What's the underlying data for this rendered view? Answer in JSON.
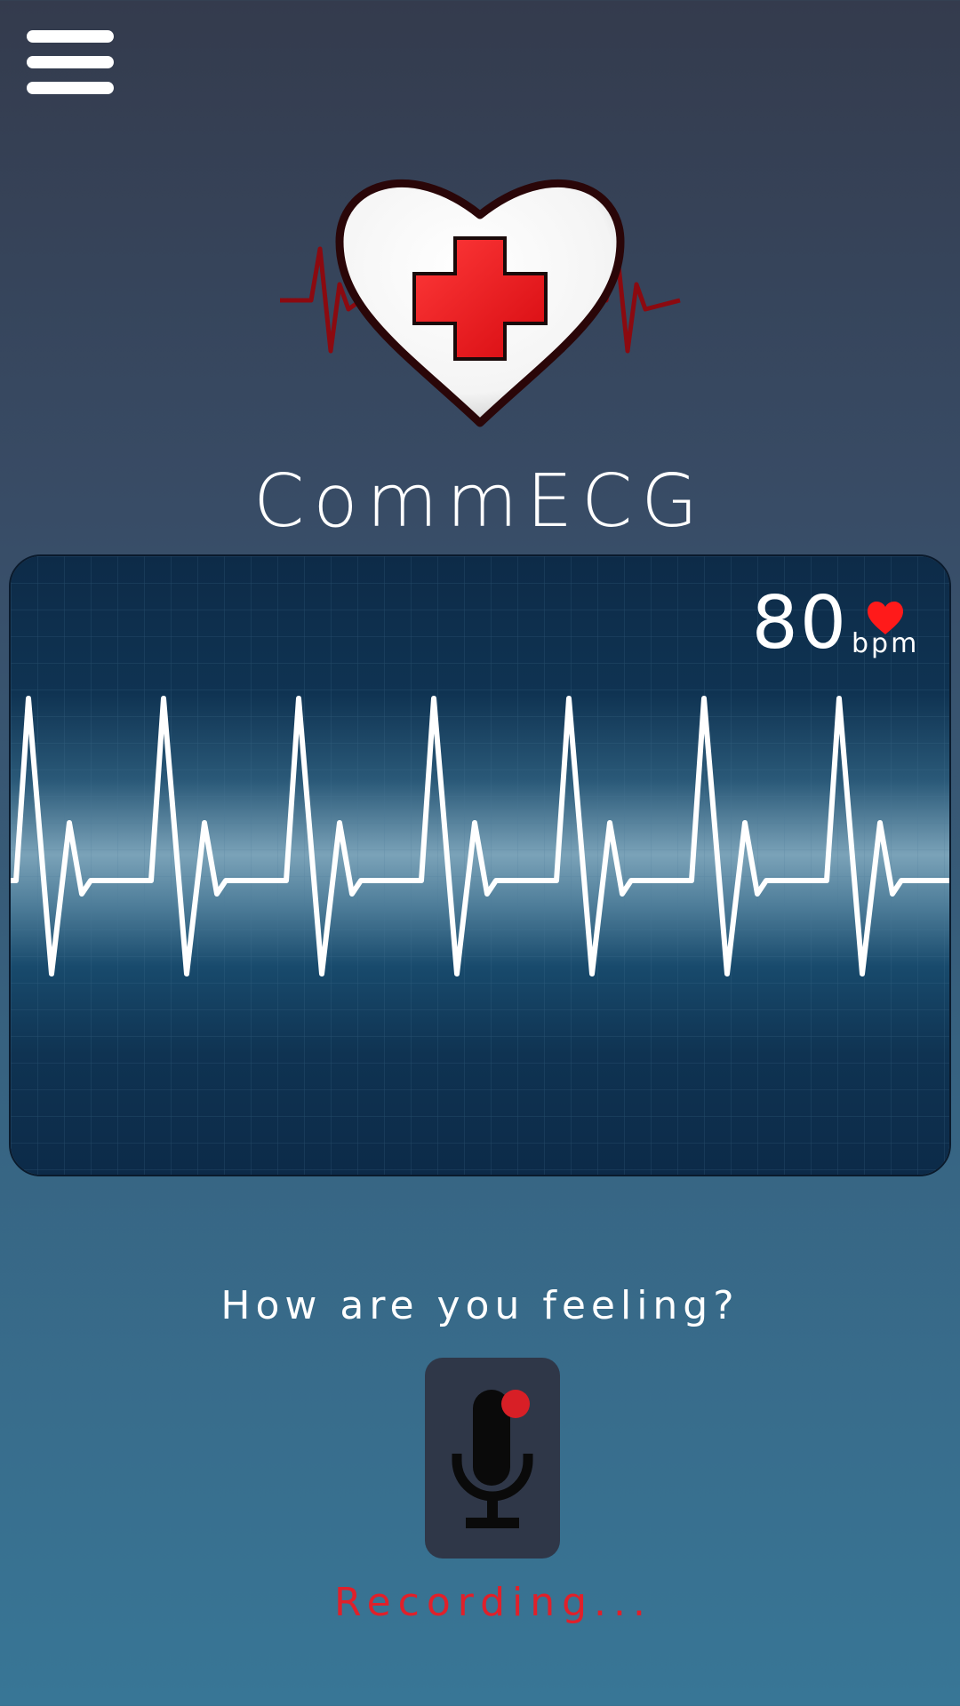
{
  "header": {
    "menu_icon": "hamburger-menu-icon"
  },
  "logo": {
    "icon": "heart-red-cross-ecg-logo",
    "colors": {
      "cross": "#e8111a",
      "heart_outline": "#2a0608",
      "ecg_line": "#8b0a10"
    }
  },
  "app": {
    "title": "CommECG"
  },
  "monitor": {
    "bpm_value": "80",
    "bpm_unit": "bpm",
    "heart_icon": "heart-icon",
    "trace_color": "#ffffff",
    "heart_color": "#ff1a1a"
  },
  "recording": {
    "prompt": "How are you feeling?",
    "mic_icon": "microphone-recording-icon",
    "status": "Recording...",
    "status_color": "#e0202a"
  }
}
